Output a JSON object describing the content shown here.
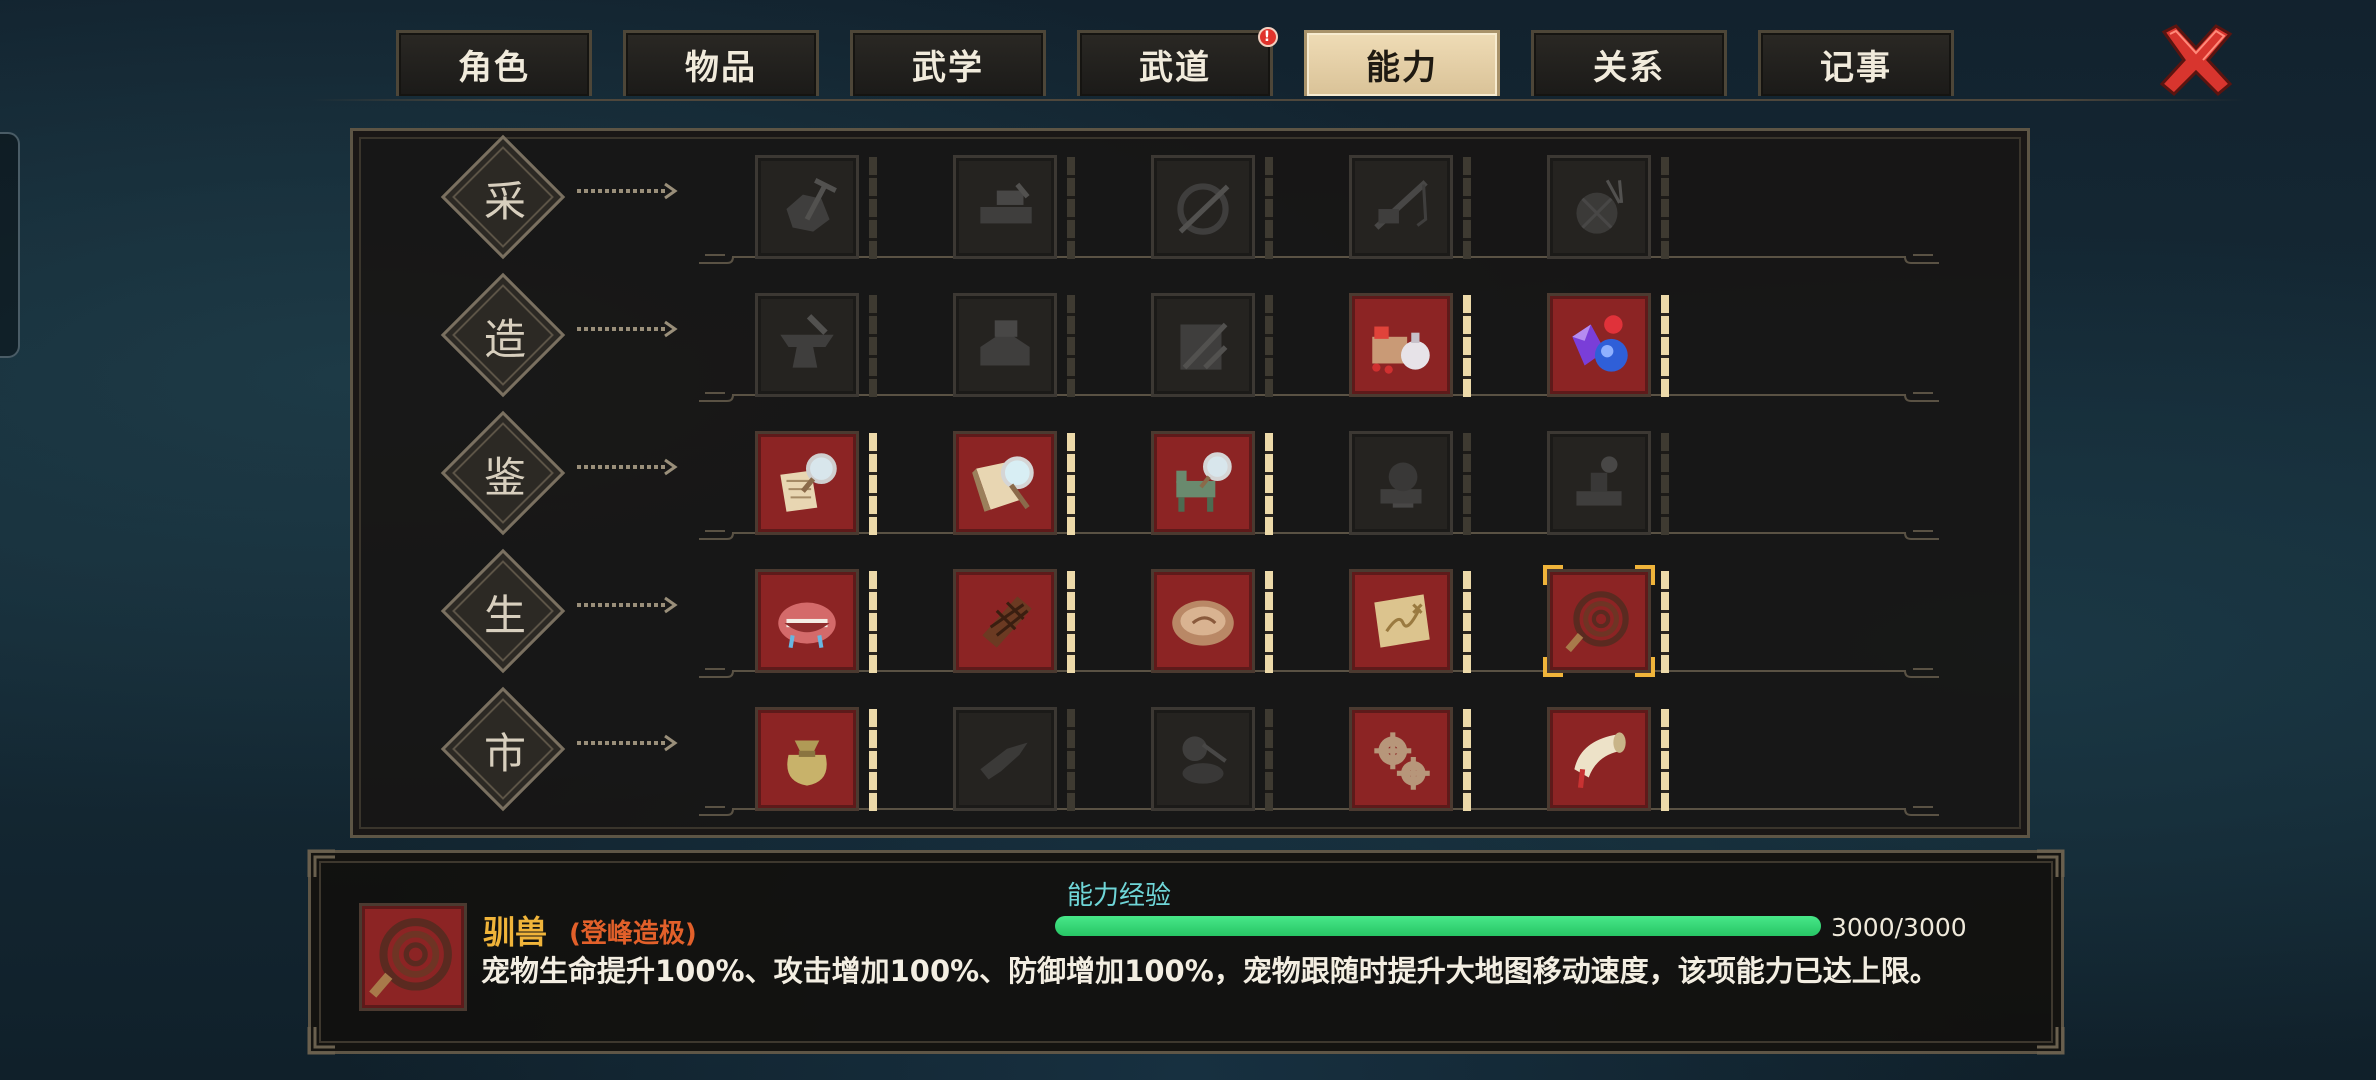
{
  "tabs": [
    {
      "label": "角色",
      "active": false,
      "badge": ""
    },
    {
      "label": "物品",
      "active": false,
      "badge": ""
    },
    {
      "label": "武学",
      "active": false,
      "badge": ""
    },
    {
      "label": "武道",
      "active": false,
      "badge": "!"
    },
    {
      "label": "能力",
      "active": true,
      "badge": ""
    },
    {
      "label": "关系",
      "active": false,
      "badge": ""
    },
    {
      "label": "记事",
      "active": false,
      "badge": ""
    }
  ],
  "categories": [
    {
      "label": "采",
      "skills": [
        {
          "icon": "ore-pickaxe-icon",
          "unlocked": false
        },
        {
          "icon": "logging-axe-icon",
          "unlocked": false
        },
        {
          "icon": "herb-sickle-icon",
          "unlocked": false
        },
        {
          "icon": "fishing-rod-icon",
          "unlocked": false
        },
        {
          "icon": "silk-needle-icon",
          "unlocked": false
        }
      ]
    },
    {
      "label": "造",
      "skills": [
        {
          "icon": "anvil-icon",
          "unlocked": false
        },
        {
          "icon": "woodwork-icon",
          "unlocked": false
        },
        {
          "icon": "tailor-scissors-icon",
          "unlocked": false
        },
        {
          "icon": "alchemy-flask-icon",
          "unlocked": true
        },
        {
          "icon": "gem-crafting-icon",
          "unlocked": true
        }
      ]
    },
    {
      "label": "鉴",
      "skills": [
        {
          "icon": "scroll-magnifier-icon",
          "unlocked": true
        },
        {
          "icon": "book-magnifier-icon",
          "unlocked": true
        },
        {
          "icon": "furniture-magnifier-icon",
          "unlocked": true
        },
        {
          "icon": "artifact-icon",
          "unlocked": false
        },
        {
          "icon": "seal-stamp-icon",
          "unlocked": false
        }
      ]
    },
    {
      "label": "生",
      "skills": [
        {
          "icon": "mouth-drool-icon",
          "unlocked": true
        },
        {
          "icon": "chocolate-bar-icon",
          "unlocked": true
        },
        {
          "icon": "wooden-bowl-icon",
          "unlocked": true
        },
        {
          "icon": "treasure-map-icon",
          "unlocked": true
        },
        {
          "icon": "coiled-whip-icon",
          "unlocked": true,
          "selected": true
        }
      ]
    },
    {
      "label": "市",
      "skills": [
        {
          "icon": "money-bag-icon",
          "unlocked": true
        },
        {
          "icon": "pointing-hand-icon",
          "unlocked": false
        },
        {
          "icon": "ink-pot-icon",
          "unlocked": false
        },
        {
          "icon": "gears-icon",
          "unlocked": true
        },
        {
          "icon": "horn-icon",
          "unlocked": true
        }
      ]
    }
  ],
  "selected": {
    "icon": "coiled-whip-icon",
    "name": "驯兽",
    "grade": "(登峰造极)",
    "exp_label": "能力经验",
    "exp_text": "3000/3000",
    "exp_progress": 1.0,
    "description": "宠物生命提升100%、攻击增加100%、防御增加100%，宠物跟随时提升大地图移动速度，该项能力已达上限。"
  },
  "colors": {
    "accent_gold": "#f0b43a",
    "grade_orange": "#e2602a",
    "exp_cyan": "#6fd6d8",
    "exp_green": "#2bd06b",
    "unlocked_red": "#8c2424",
    "close_red": "#d8352e"
  }
}
